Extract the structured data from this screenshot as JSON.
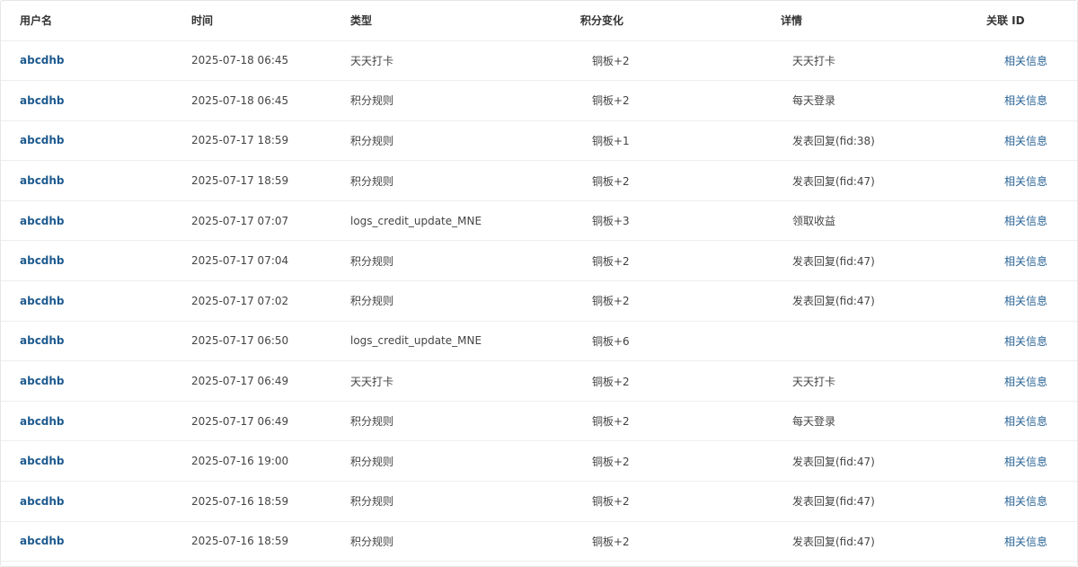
{
  "table": {
    "headers": {
      "username": "用户名",
      "time": "时间",
      "type": "类型",
      "credit_change": "积分变化",
      "detail": "详情",
      "related_id": "关联 ID"
    },
    "rows": [
      {
        "username": "abcdhb",
        "time": "2025-07-18 06:45",
        "type": "天天打卡",
        "credit_change": "铜板+2",
        "detail": "天天打卡",
        "related": "相关信息"
      },
      {
        "username": "abcdhb",
        "time": "2025-07-18 06:45",
        "type": "积分规则",
        "credit_change": "铜板+2",
        "detail": "每天登录",
        "related": "相关信息"
      },
      {
        "username": "abcdhb",
        "time": "2025-07-17 18:59",
        "type": "积分规则",
        "credit_change": "铜板+1",
        "detail": "发表回复(fid:38)",
        "related": "相关信息"
      },
      {
        "username": "abcdhb",
        "time": "2025-07-17 18:59",
        "type": "积分规则",
        "credit_change": "铜板+2",
        "detail": "发表回复(fid:47)",
        "related": "相关信息"
      },
      {
        "username": "abcdhb",
        "time": "2025-07-17 07:07",
        "type": "logs_credit_update_MNE",
        "credit_change": "铜板+3",
        "detail": "领取收益",
        "related": "相关信息"
      },
      {
        "username": "abcdhb",
        "time": "2025-07-17 07:04",
        "type": "积分规则",
        "credit_change": "铜板+2",
        "detail": "发表回复(fid:47)",
        "related": "相关信息"
      },
      {
        "username": "abcdhb",
        "time": "2025-07-17 07:02",
        "type": "积分规则",
        "credit_change": "铜板+2",
        "detail": "发表回复(fid:47)",
        "related": "相关信息"
      },
      {
        "username": "abcdhb",
        "time": "2025-07-17 06:50",
        "type": "logs_credit_update_MNE",
        "credit_change": "铜板+6",
        "detail": "",
        "related": "相关信息"
      },
      {
        "username": "abcdhb",
        "time": "2025-07-17 06:49",
        "type": "天天打卡",
        "credit_change": "铜板+2",
        "detail": "天天打卡",
        "related": "相关信息"
      },
      {
        "username": "abcdhb",
        "time": "2025-07-17 06:49",
        "type": "积分规则",
        "credit_change": "铜板+2",
        "detail": "每天登录",
        "related": "相关信息"
      },
      {
        "username": "abcdhb",
        "time": "2025-07-16 19:00",
        "type": "积分规则",
        "credit_change": "铜板+2",
        "detail": "发表回复(fid:47)",
        "related": "相关信息"
      },
      {
        "username": "abcdhb",
        "time": "2025-07-16 18:59",
        "type": "积分规则",
        "credit_change": "铜板+2",
        "detail": "发表回复(fid:47)",
        "related": "相关信息"
      },
      {
        "username": "abcdhb",
        "time": "2025-07-16 18:59",
        "type": "积分规则",
        "credit_change": "铜板+2",
        "detail": "发表回复(fid:47)",
        "related": "相关信息"
      }
    ]
  }
}
